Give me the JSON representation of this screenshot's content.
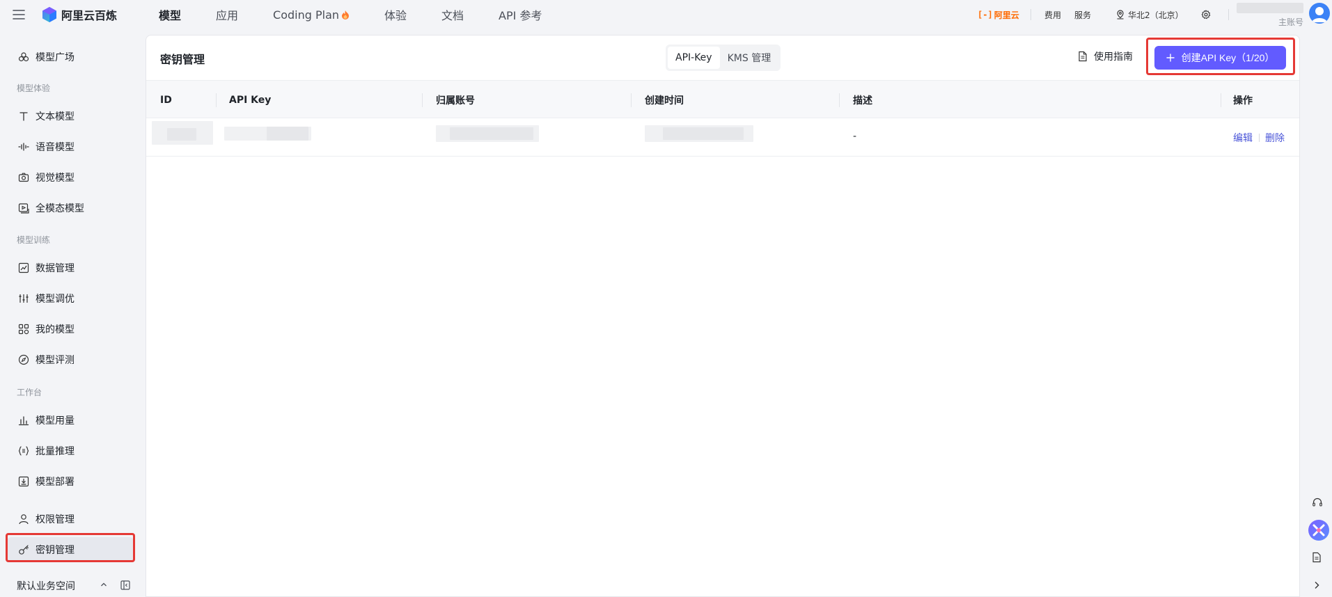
{
  "topbar": {
    "brand": "阿里云百炼",
    "nav": [
      {
        "label": "模型",
        "active": true
      },
      {
        "label": "应用",
        "active": false
      },
      {
        "label": "Coding Plan",
        "active": false,
        "badge_icon": "fire-icon"
      },
      {
        "label": "体验",
        "active": false
      },
      {
        "label": "文档",
        "active": false
      },
      {
        "label": "API 参考",
        "active": false
      }
    ],
    "aliyun_logo": "阿里云",
    "links": {
      "fees": "费用",
      "service": "服务"
    },
    "region": "华北2（北京）",
    "account_label": "主账号"
  },
  "sidebar": {
    "top_item": "模型广场",
    "sections": {
      "experience": "模型体验",
      "training": "模型训练",
      "workbench": "工作台"
    },
    "experience_items": [
      "文本模型",
      "语音模型",
      "视觉模型",
      "全模态模型"
    ],
    "training_items": [
      "数据管理",
      "模型调优",
      "我的模型",
      "模型评测"
    ],
    "workbench_items": [
      "模型用量",
      "批量推理",
      "模型部署"
    ],
    "bottom_items": [
      "权限管理",
      "密钥管理"
    ],
    "active_item": "密钥管理",
    "workspace": "默认业务空间"
  },
  "main": {
    "title": "密钥管理",
    "tabs": [
      {
        "label": "API-Key",
        "active": true
      },
      {
        "label": "KMS 管理",
        "active": false
      }
    ],
    "guide_label": "使用指南",
    "create_button": "创建API Key（1/20）",
    "table": {
      "columns": [
        "ID",
        "API Key",
        "归属账号",
        "创建时间",
        "描述",
        "操作"
      ],
      "rows": [
        {
          "description": "-",
          "actions": [
            "编辑",
            "删除"
          ]
        }
      ]
    }
  },
  "colors": {
    "primary": "#625bff",
    "link": "#4a55d8",
    "highlight": "#e53935",
    "aliyun_orange": "#ff6a00"
  }
}
